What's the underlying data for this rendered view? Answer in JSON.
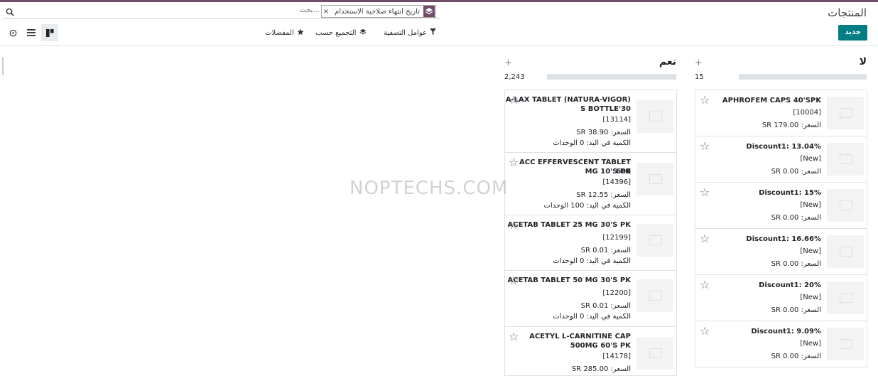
{
  "app": {
    "title": "المنتجات",
    "new_button": "جديد"
  },
  "search": {
    "placeholder": "بحث...",
    "facet_label": "تاريخ انتهاء صلاحية الاستخدام",
    "facet_remove": "×"
  },
  "controls": {
    "filters": "عوامل التصفية",
    "group_by": "التجميع حسب",
    "favorites": "المفضلات"
  },
  "views": [
    "kanban-view-icon",
    "list-view-icon",
    "activity-view-icon"
  ],
  "watermark": "NOPTECHS.COM",
  "columns": [
    {
      "title": "لا",
      "count": "15",
      "cards": [
        {
          "name": "APHROFEM CAPS 40'SPK",
          "code": "[10004]",
          "price": "السعر: 179.00 SR"
        },
        {
          "name": "Discount1: 13.04%",
          "code": "[New]",
          "price": "السعر: 0.00 SR"
        },
        {
          "name": "Discount1: 15%",
          "code": "[New]",
          "price": "السعر: 0.00 SR"
        },
        {
          "name": "Discount1: 16.66%",
          "code": "[New]",
          "price": "السعر: 0.00 SR"
        },
        {
          "name": "Discount1: 20%",
          "code": "[New]",
          "price": "السعر: 0.00 SR"
        },
        {
          "name": "Discount1: 9.09%",
          "code": "[New]",
          "price": "السعر: 0.00 SR"
        }
      ]
    },
    {
      "title": "نعم",
      "count": "2,243",
      "cards": [
        {
          "name1": "A-LAX TABLET (NATURA-VIGOR)",
          "name2": "30'S BOTTLE",
          "code": "[13114]",
          "price": "السعر: 38.90 SR",
          "qty": "الكمية في اليد: 0 الوحدات"
        },
        {
          "name1": "ACC EFFERVESCENT TABLET 600",
          "name2": "MG 10'S PK",
          "code": "[14396]",
          "price": "السعر: 12.55 SR",
          "qty": "الكمية في اليد: 100 الوحدات"
        },
        {
          "name1": "ACETAB TABLET 25 MG 30'S PK",
          "name2": "",
          "code": "[12199]",
          "price": "السعر: 0.01 SR",
          "qty": "الكمية في اليد: 0 الوحدات"
        },
        {
          "name1": "ACETAB TABLET 50 MG 30'S PK",
          "name2": "",
          "code": "[12200]",
          "price": "السعر: 0.01 SR",
          "qty": "الكمية في اليد: 0 الوحدات"
        },
        {
          "name1": "ACETYL L-CARNITINE CAP",
          "name2": "500MG 60'S PK",
          "code": "[14178]",
          "price": "السعر: 285.00 SR",
          "qty": ""
        }
      ]
    }
  ]
}
